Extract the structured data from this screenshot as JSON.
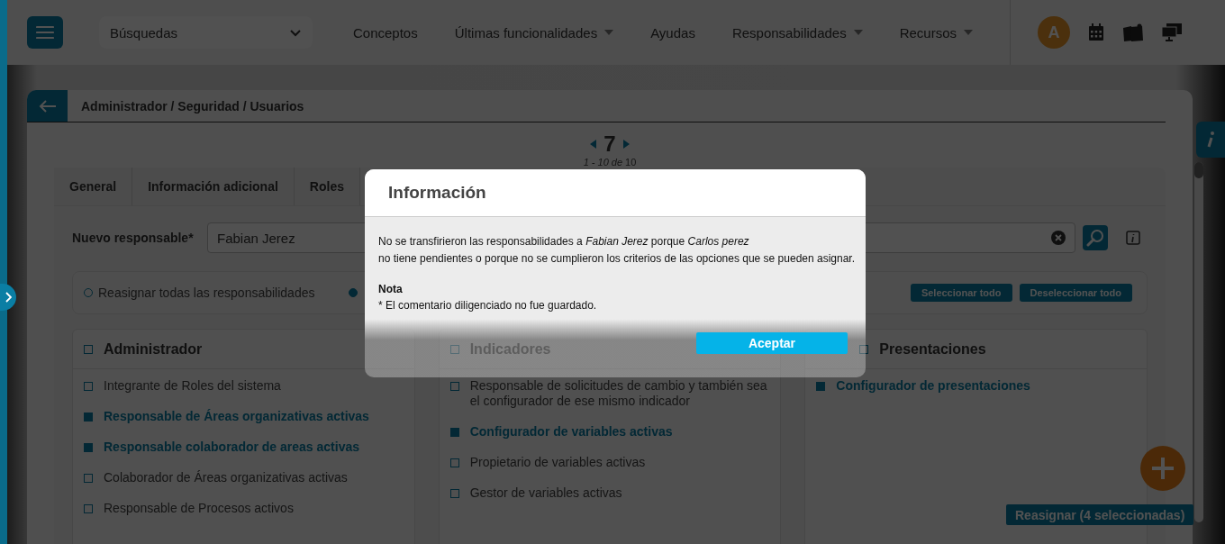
{
  "topbar": {
    "search_select": "Búsquedas",
    "avatar": "A",
    "nav": [
      {
        "label": "Conceptos",
        "dropdown": false
      },
      {
        "label": "Últimas funcionalidades",
        "dropdown": true
      },
      {
        "label": "Ayudas",
        "dropdown": false
      },
      {
        "label": "Responsabilidades",
        "dropdown": true
      },
      {
        "label": "Recursos",
        "dropdown": true
      }
    ]
  },
  "breadcrumb": "Administrador / Seguridad / Usuarios",
  "pager": {
    "current": "7",
    "range": "*1 - 10 de* 10"
  },
  "tabs": [
    {
      "label": "General",
      "selected": false
    },
    {
      "label": "Información adicional",
      "selected": false
    },
    {
      "label": "Roles",
      "selected": false
    }
  ],
  "new_owner": {
    "label": "Nuevo responsable*",
    "value": "Fabian Jerez"
  },
  "modes": [
    {
      "label": "Reasignar todas las responsabilidades",
      "selected": false
    },
    {
      "selected": true
    }
  ],
  "select_buttons": [
    "Seleccionar todo",
    "Deseleccionar todo"
  ],
  "groups": [
    {
      "title": "Administrador",
      "checked": false,
      "items": [
        {
          "label": "Integrante de Roles del sistema",
          "checked": false
        },
        {
          "label": "Responsable de Áreas organizativas activas",
          "checked": true
        },
        {
          "label": "Responsable colaborador de areas activas",
          "checked": true
        },
        {
          "label": "Colaborador de Áreas organizativas activas",
          "checked": false
        },
        {
          "label": "Responsable de Procesos activos",
          "checked": false
        }
      ]
    },
    {
      "title": "Indicadores",
      "checked": false,
      "items": [
        {
          "label": "Responsable de solicitudes de cambio y también sea el configurador de ese mismo indicador",
          "checked": false
        },
        {
          "label": "Configurador de variables activas",
          "checked": true
        },
        {
          "label": "Propietario de variables activas",
          "checked": false
        },
        {
          "label": "Gestor de variables activas",
          "checked": false
        }
      ]
    },
    {
      "title": "Presentaciones",
      "checked": false,
      "items": [
        {
          "label": "Configurador de presentaciones",
          "checked": true
        }
      ]
    }
  ],
  "reassign_button": "Reasignar (4 seleccionadas)",
  "dialog": {
    "title": "Información",
    "message": [
      "No se transfirieron las responsabilidades a *Fabian Jerez* porque *Carlos perez*",
      "no tiene pendientes o porque no se cumplieron los criterios de las opciones que se pueden asignar."
    ],
    "note_title": "Nota",
    "note": "* El comentario diligenciado no fue guardado.",
    "button": "Aceptar"
  }
}
